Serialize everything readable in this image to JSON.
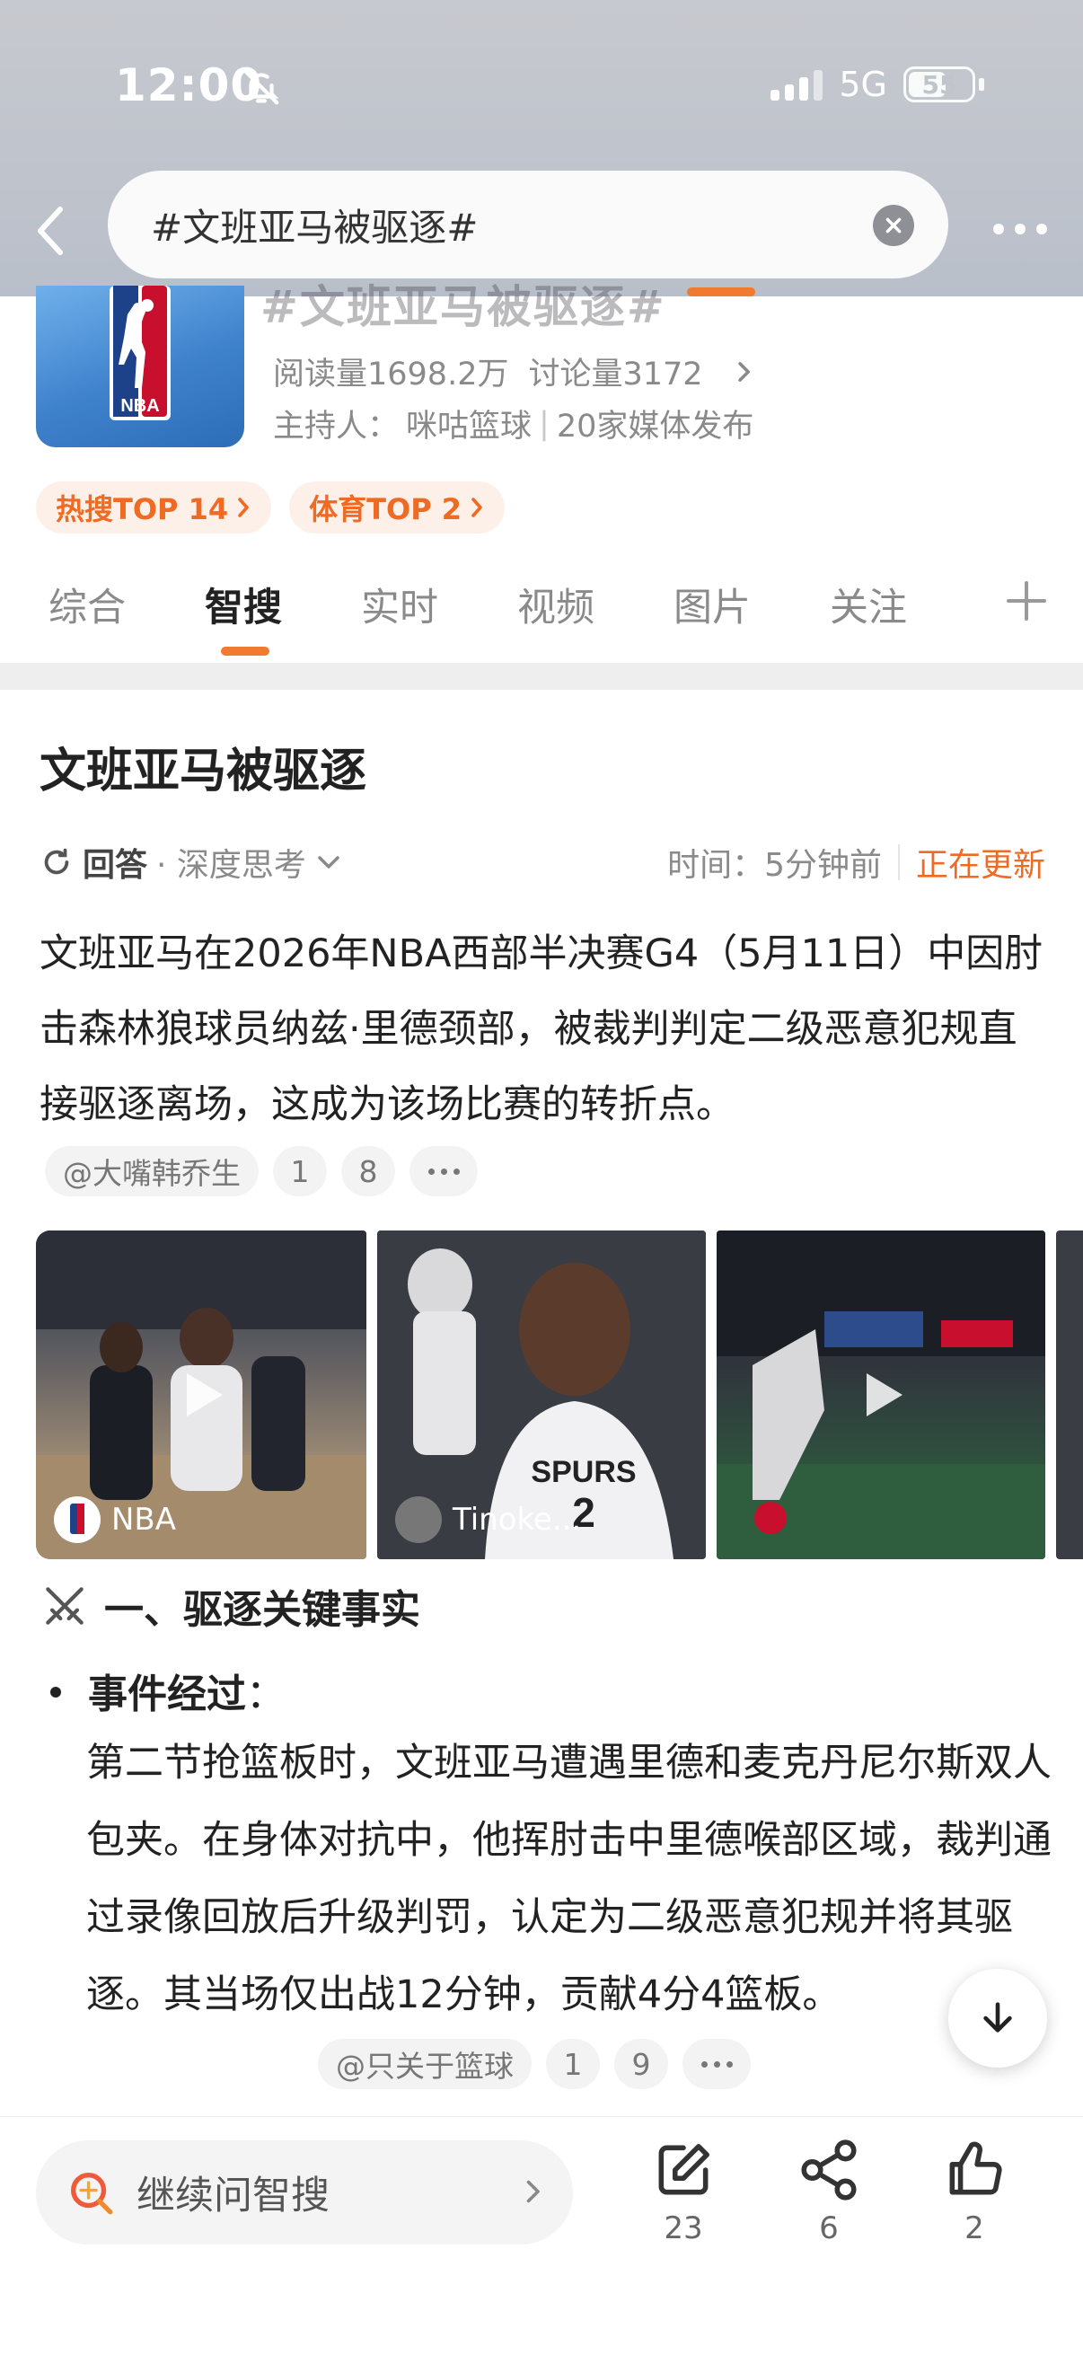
{
  "status_bar": {
    "time": "12:00",
    "network": "5G",
    "battery": "55"
  },
  "search": {
    "query": "#文班亚马被驱逐#"
  },
  "topic": {
    "ghost_title": "#文班亚马被驱逐#",
    "logo_text": "NBA",
    "reads": "阅读量1698.2万",
    "discussions": "讨论量3172",
    "host_label": "主持人：",
    "host": "咪咕篮球",
    "media": "20家媒体发布",
    "tags": [
      "热搜TOP 14",
      "体育TOP 2"
    ]
  },
  "tabs": [
    "综合",
    "智搜",
    "实时",
    "视频",
    "图片",
    "关注"
  ],
  "answer": {
    "title": "文班亚马被驱逐",
    "mode": "回答",
    "mode_sub": "· 深度思考",
    "time": "时间：5分钟前",
    "status": "正在更新",
    "paragraph": "文班亚马在2026年NBA西部半决赛G4（5月11日）中因肘击森林狼球员纳兹·里德颈部，被裁判判定二级恶意犯规直接驱逐离场，这成为该场比赛的转折点。",
    "source1": {
      "name": "@大嘴韩乔生",
      "n1": "1",
      "n2": "8"
    },
    "media": [
      {
        "author": "NBA"
      },
      {
        "author": "Tinoke..."
      }
    ],
    "section_title": "一、驱逐关键事实",
    "bullet_label": "事件经过",
    "bullet_colon": "：",
    "bullet_body": "第二节抢篮板时，文班亚马遭遇里德和麦克丹尼尔斯双人包夹。在身体对抗中，他挥肘击中里德喉部区域，裁判通过录像回放后升级判罚，认定为二级恶意犯规并将其驱逐。其当场仅出战12分钟，贡献4分4篮板。",
    "source2": {
      "name": "@只关于篮球",
      "n1": "1",
      "n2": "9"
    }
  },
  "bottom": {
    "ask_label": "继续问智搜",
    "comment_count": "23",
    "share_count": "6",
    "like_count": "2"
  },
  "icons": [
    "back-icon",
    "clear-icon",
    "more-icon",
    "bell-off-icon",
    "plus-icon",
    "play-icon",
    "sparkle-search-icon",
    "crossed-swords-icon",
    "arrow-down-icon",
    "edit-icon",
    "share-icon",
    "thumbs-up-icon"
  ],
  "colors": {
    "accent": "#ef6a22",
    "tag_bg": "#fdf0e8"
  }
}
